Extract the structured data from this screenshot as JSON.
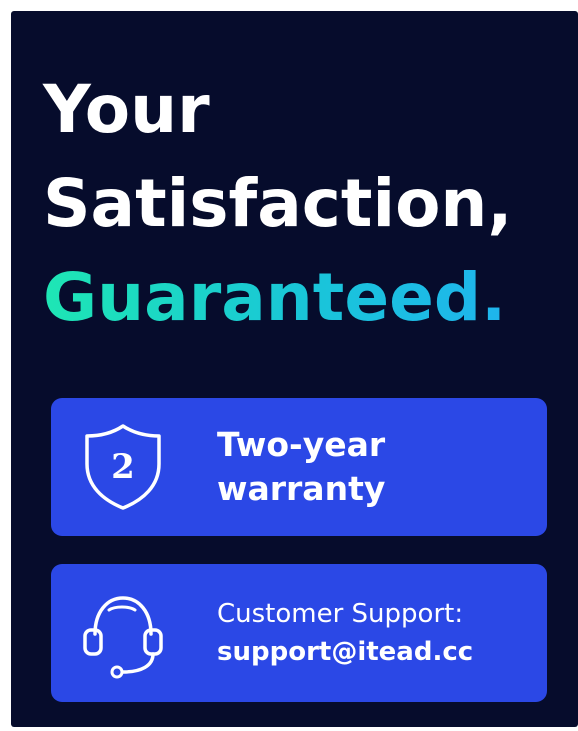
{
  "headline": {
    "line1": "Your",
    "line2": "Satisfaction,",
    "line3": "Guaranteed."
  },
  "colors": {
    "background": "#060c2c",
    "card": "#2b48e6",
    "accent_start": "#1ee6b4",
    "accent_end": "#1fb4ee"
  },
  "warranty": {
    "icon": "shield-icon",
    "badge_number": "2",
    "line1": "Two-year",
    "line2": "warranty"
  },
  "support": {
    "icon": "headset-icon",
    "label": "Customer Support:",
    "email": "support@itead.cc"
  }
}
